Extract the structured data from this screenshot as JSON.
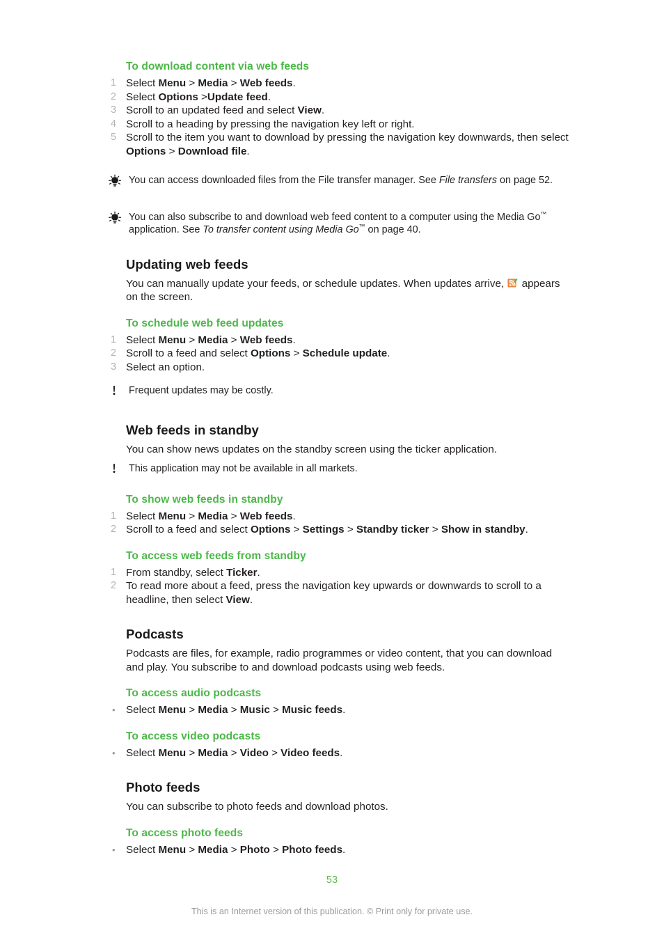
{
  "document": {
    "page_number": "53",
    "footer_note": "This is an Internet version of this publication. © Print only for private use.",
    "accent_green": "#4cb848",
    "page_number_green": "#5cbb4a",
    "body_color": "#231f20",
    "step_number_color": "#b3b3b3"
  },
  "sections": [
    {
      "id": "download-via-web-feeds",
      "heading": "To download content via web feeds",
      "steps": [
        {
          "num": "1",
          "parts": [
            {
              "t": "Select ",
              "b": false
            },
            {
              "t": "Menu",
              "b": true
            },
            {
              "t": " > ",
              "b": false
            },
            {
              "t": "Media",
              "b": true
            },
            {
              "t": " > ",
              "b": false
            },
            {
              "t": "Web feeds",
              "b": true
            },
            {
              "t": ".",
              "b": false
            }
          ]
        },
        {
          "num": "2",
          "parts": [
            {
              "t": "Select ",
              "b": false
            },
            {
              "t": "Options",
              "b": true
            },
            {
              "t": " >",
              "b": false
            },
            {
              "t": "Update feed",
              "b": true
            },
            {
              "t": ".",
              "b": false
            }
          ]
        },
        {
          "num": "3",
          "parts": [
            {
              "t": "Scroll to an updated feed and select ",
              "b": false
            },
            {
              "t": "View",
              "b": true
            },
            {
              "t": ".",
              "b": false
            }
          ]
        },
        {
          "num": "4",
          "parts": [
            {
              "t": "Scroll to a heading by pressing the navigation key left or right.",
              "b": false
            }
          ]
        },
        {
          "num": "5",
          "parts": [
            {
              "t": "Scroll to the item you want to download by pressing the navigation key downwards, then select ",
              "b": false
            },
            {
              "t": "Options",
              "b": true
            },
            {
              "t": " > ",
              "b": false
            },
            {
              "t": "Download file",
              "b": true
            },
            {
              "t": ".",
              "b": false
            }
          ]
        }
      ]
    }
  ],
  "notes": {
    "tip_file_transfer": {
      "icon": "lightbulb-tip-icon",
      "parts": [
        {
          "t": "You can access downloaded files from the File transfer manager. See ",
          "i": false
        },
        {
          "t": "File transfers",
          "i": true
        },
        {
          "t": " on page 52.",
          "i": false
        }
      ]
    },
    "tip_media_go": {
      "icon": "lightbulb-tip-icon",
      "parts": [
        {
          "t": "You can also subscribe to and download web feed content to a computer using the Media Go",
          "i": false,
          "tm": true
        },
        {
          "t": " application. See ",
          "i": false
        },
        {
          "t": "To transfer content using Media Go",
          "i": true,
          "tm_italic": true
        },
        {
          "t": " on page 40.",
          "i": false
        }
      ]
    },
    "warn_costly": {
      "icon": "exclamation-warning-icon",
      "text": "Frequent updates may be costly."
    },
    "warn_markets": {
      "icon": "exclamation-warning-icon",
      "text": "This application may not be available in all markets."
    }
  },
  "updating_web_feeds": {
    "heading": "Updating web feeds",
    "intro_before_icon": "You can manually update your feeds, or schedule updates. When updates arrive,",
    "inline_icon": "rss-feed-updated-icon",
    "intro_after_icon": "appears on the screen.",
    "sub_heading": "To schedule web feed updates",
    "steps": [
      {
        "num": "1",
        "parts": [
          {
            "t": "Select ",
            "b": false
          },
          {
            "t": "Menu",
            "b": true
          },
          {
            "t": " > ",
            "b": false
          },
          {
            "t": "Media",
            "b": true
          },
          {
            "t": " > ",
            "b": false
          },
          {
            "t": "Web feeds",
            "b": true
          },
          {
            "t": ".",
            "b": false
          }
        ]
      },
      {
        "num": "2",
        "parts": [
          {
            "t": "Scroll to a feed and select ",
            "b": false
          },
          {
            "t": "Options",
            "b": true
          },
          {
            "t": " > ",
            "b": false
          },
          {
            "t": "Schedule update",
            "b": true
          },
          {
            "t": ".",
            "b": false
          }
        ]
      },
      {
        "num": "3",
        "parts": [
          {
            "t": "Select an option.",
            "b": false
          }
        ]
      }
    ]
  },
  "web_feeds_standby": {
    "heading": "Web feeds in standby",
    "intro": "You can show news updates on the standby screen using the ticker application.",
    "sub_show": {
      "heading": "To show web feeds in standby",
      "steps": [
        {
          "num": "1",
          "parts": [
            {
              "t": "Select ",
              "b": false
            },
            {
              "t": "Menu",
              "b": true
            },
            {
              "t": " > ",
              "b": false
            },
            {
              "t": "Media",
              "b": true
            },
            {
              "t": " > ",
              "b": false
            },
            {
              "t": "Web feeds",
              "b": true
            },
            {
              "t": ".",
              "b": false
            }
          ]
        },
        {
          "num": "2",
          "parts": [
            {
              "t": "Scroll to a feed and select ",
              "b": false
            },
            {
              "t": "Options",
              "b": true
            },
            {
              "t": " > ",
              "b": false
            },
            {
              "t": "Settings",
              "b": true
            },
            {
              "t": " > ",
              "b": false
            },
            {
              "t": "Standby ticker",
              "b": true
            },
            {
              "t": " > ",
              "b": false
            },
            {
              "t": "Show in standby",
              "b": true
            },
            {
              "t": ".",
              "b": false
            }
          ]
        }
      ]
    },
    "sub_access": {
      "heading": "To access web feeds from standby",
      "steps": [
        {
          "num": "1",
          "parts": [
            {
              "t": "From standby, select ",
              "b": false
            },
            {
              "t": "Ticker",
              "b": true
            },
            {
              "t": ".",
              "b": false
            }
          ]
        },
        {
          "num": "2",
          "parts": [
            {
              "t": "To read more about a feed, press the navigation key upwards or downwards to scroll to a headline, then select ",
              "b": false
            },
            {
              "t": "View",
              "b": true
            },
            {
              "t": ".",
              "b": false
            }
          ]
        }
      ]
    }
  },
  "podcasts": {
    "heading": "Podcasts",
    "intro": "Podcasts are files, for example, radio programmes or video content, that you can download and play. You subscribe to and download podcasts using web feeds.",
    "audio": {
      "heading": "To access audio podcasts",
      "bullet": "•",
      "parts": [
        {
          "t": "Select ",
          "b": false
        },
        {
          "t": "Menu",
          "b": true
        },
        {
          "t": " > ",
          "b": false
        },
        {
          "t": "Media",
          "b": true
        },
        {
          "t": " > ",
          "b": false
        },
        {
          "t": "Music",
          "b": true
        },
        {
          "t": " > ",
          "b": false
        },
        {
          "t": "Music feeds",
          "b": true
        },
        {
          "t": ".",
          "b": false
        }
      ]
    },
    "video": {
      "heading": "To access video podcasts",
      "bullet": "•",
      "parts": [
        {
          "t": "Select ",
          "b": false
        },
        {
          "t": "Menu",
          "b": true
        },
        {
          "t": " > ",
          "b": false
        },
        {
          "t": "Media",
          "b": true
        },
        {
          "t": " > ",
          "b": false
        },
        {
          "t": "Video",
          "b": true
        },
        {
          "t": " > ",
          "b": false
        },
        {
          "t": "Video feeds",
          "b": true
        },
        {
          "t": ".",
          "b": false
        }
      ]
    }
  },
  "photo_feeds": {
    "heading": "Photo feeds",
    "intro": "You can subscribe to photo feeds and download photos.",
    "access": {
      "heading": "To access photo feeds",
      "bullet": "•",
      "parts": [
        {
          "t": "Select ",
          "b": false
        },
        {
          "t": "Menu",
          "b": true
        },
        {
          "t": " > ",
          "b": false
        },
        {
          "t": "Media",
          "b": true
        },
        {
          "t": " > ",
          "b": false
        },
        {
          "t": "Photo",
          "b": true
        },
        {
          "t": " > ",
          "b": false
        },
        {
          "t": "Photo feeds",
          "b": true
        },
        {
          "t": ".",
          "b": false
        }
      ]
    }
  }
}
